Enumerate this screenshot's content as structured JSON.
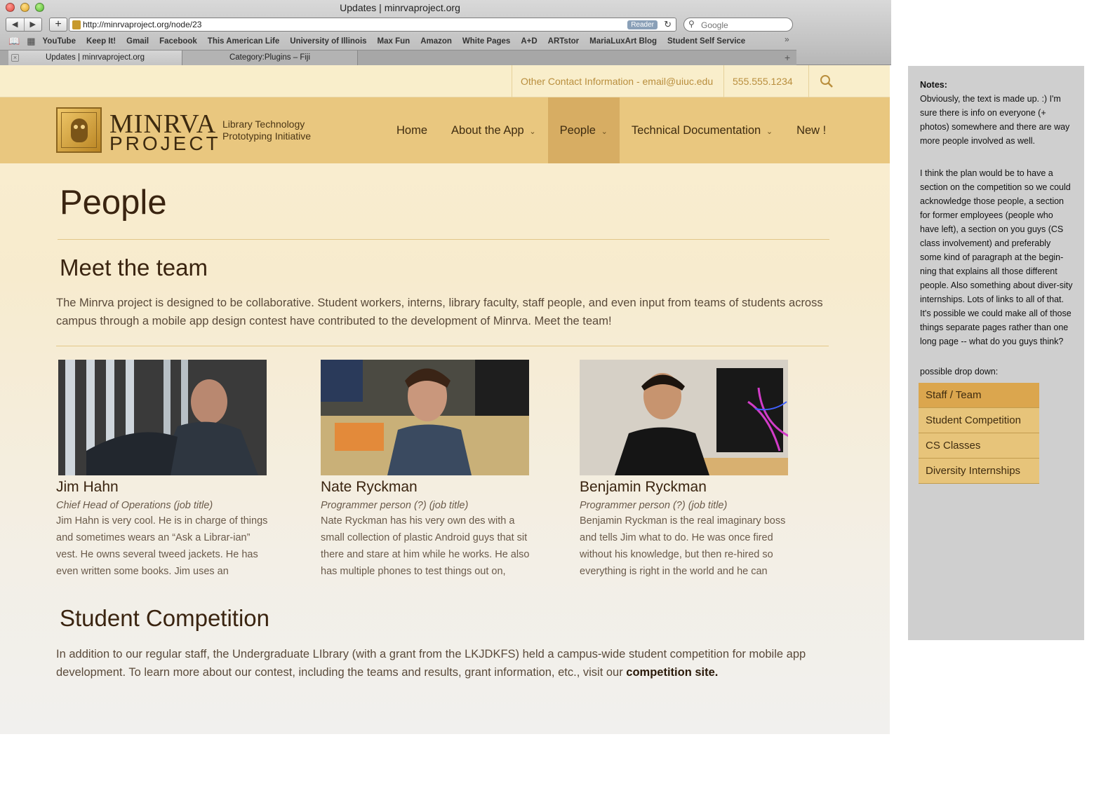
{
  "window": {
    "title": "Updates | minrvaproject.org"
  },
  "browser": {
    "url": "http://minrvaproject.org/node/23",
    "reader_label": "Reader",
    "search_placeholder": "Google",
    "bookmarks": [
      "YouTube",
      "Keep It!",
      "Gmail",
      "Facebook",
      "This American Life",
      "University of Illinois",
      "Max Fun",
      "Amazon",
      "White Pages",
      "A+D",
      "ARTstor",
      "MariaLuxArt Blog",
      "Student Self Service"
    ],
    "tabs": [
      {
        "label": "Updates | minrvaproject.org",
        "active": true
      },
      {
        "label": "Category:Plugins – Fiji",
        "active": false
      }
    ]
  },
  "site": {
    "contact": "Other Contact Information - email@uiuc.edu",
    "phone": "555.555.1234",
    "brand_top": "MINRVA",
    "brand_bottom": "PROJECT",
    "tagline": "Library Technology Prototyping Initiative",
    "nav": [
      {
        "label": "Home",
        "dropdown": false
      },
      {
        "label": "About the App",
        "dropdown": true
      },
      {
        "label": "People",
        "dropdown": true,
        "active": true
      },
      {
        "label": "Technical Documentation",
        "dropdown": true
      },
      {
        "label": "New !",
        "dropdown": false
      }
    ]
  },
  "main": {
    "page_title": "People",
    "section_title": "Meet the team",
    "intro": "The Minrva project is designed to be collaborative. Student workers, interns, library faculty, staff people, and even input from teams of students across campus through a mobile app design contest have contributed to the development of Minrva. Meet the team!",
    "people": [
      {
        "name": "Jim Hahn",
        "title": "Chief Head of Operations (job title)",
        "bio": "Jim Hahn is very cool. He is in charge of things and sometimes wears an “Ask a Librar-ian” vest. He owns several tweed jackets. He has even written some books. Jim uses an"
      },
      {
        "name": "Nate Ryckman",
        "title": "Programmer person (?) (job title)",
        "bio": "Nate Ryckman has his very own des with a small collection of plastic Android guys that sit there and stare at him while he works. He also has multiple phones to test things out on,"
      },
      {
        "name": "Benjamin Ryckman",
        "title": "Programmer person (?) (job title)",
        "bio": "Benjamin Ryckman is the real imaginary boss and tells Jim what to do. He was once fired without his knowledge, but then re-hired so everything is right in the world and he can"
      }
    ],
    "competition_title": "Student Competition",
    "competition_text": "In addition to our regular staff, the Undergraduate LIbrary (with a grant from the LKJDKFS) held a campus-wide student competition for mobile app development. To learn more about our contest, including the teams and results, grant information, etc., visit our ",
    "competition_link": "competition site."
  },
  "notes": {
    "label": "Notes:",
    "p1": "Obviously, the text is made up. :) I'm sure there is info on everyone (+ photos) somewhere and there are way more people involved as well.",
    "p2": "I think the plan would be to have a section on the competition so we could acknowledge those people, a section for former employees (people who have left), a section on you guys (CS class involvement) and preferably some kind of paragraph at the begin-ning that explains all those different people. Also something about diver-sity internships. Lots of links to all of that. It's possible we could make all of those things separate pages rather than one long page -- what do you guys think?",
    "dropdown_label": "possible drop down:",
    "dropdown": [
      "Staff / Team",
      "Student Competition",
      "CS Classes",
      "Diversity Internships"
    ]
  },
  "colors": {
    "header": "#e9c77f",
    "nav_active": "#d7ad63",
    "accent_text": "#b98e3d"
  }
}
